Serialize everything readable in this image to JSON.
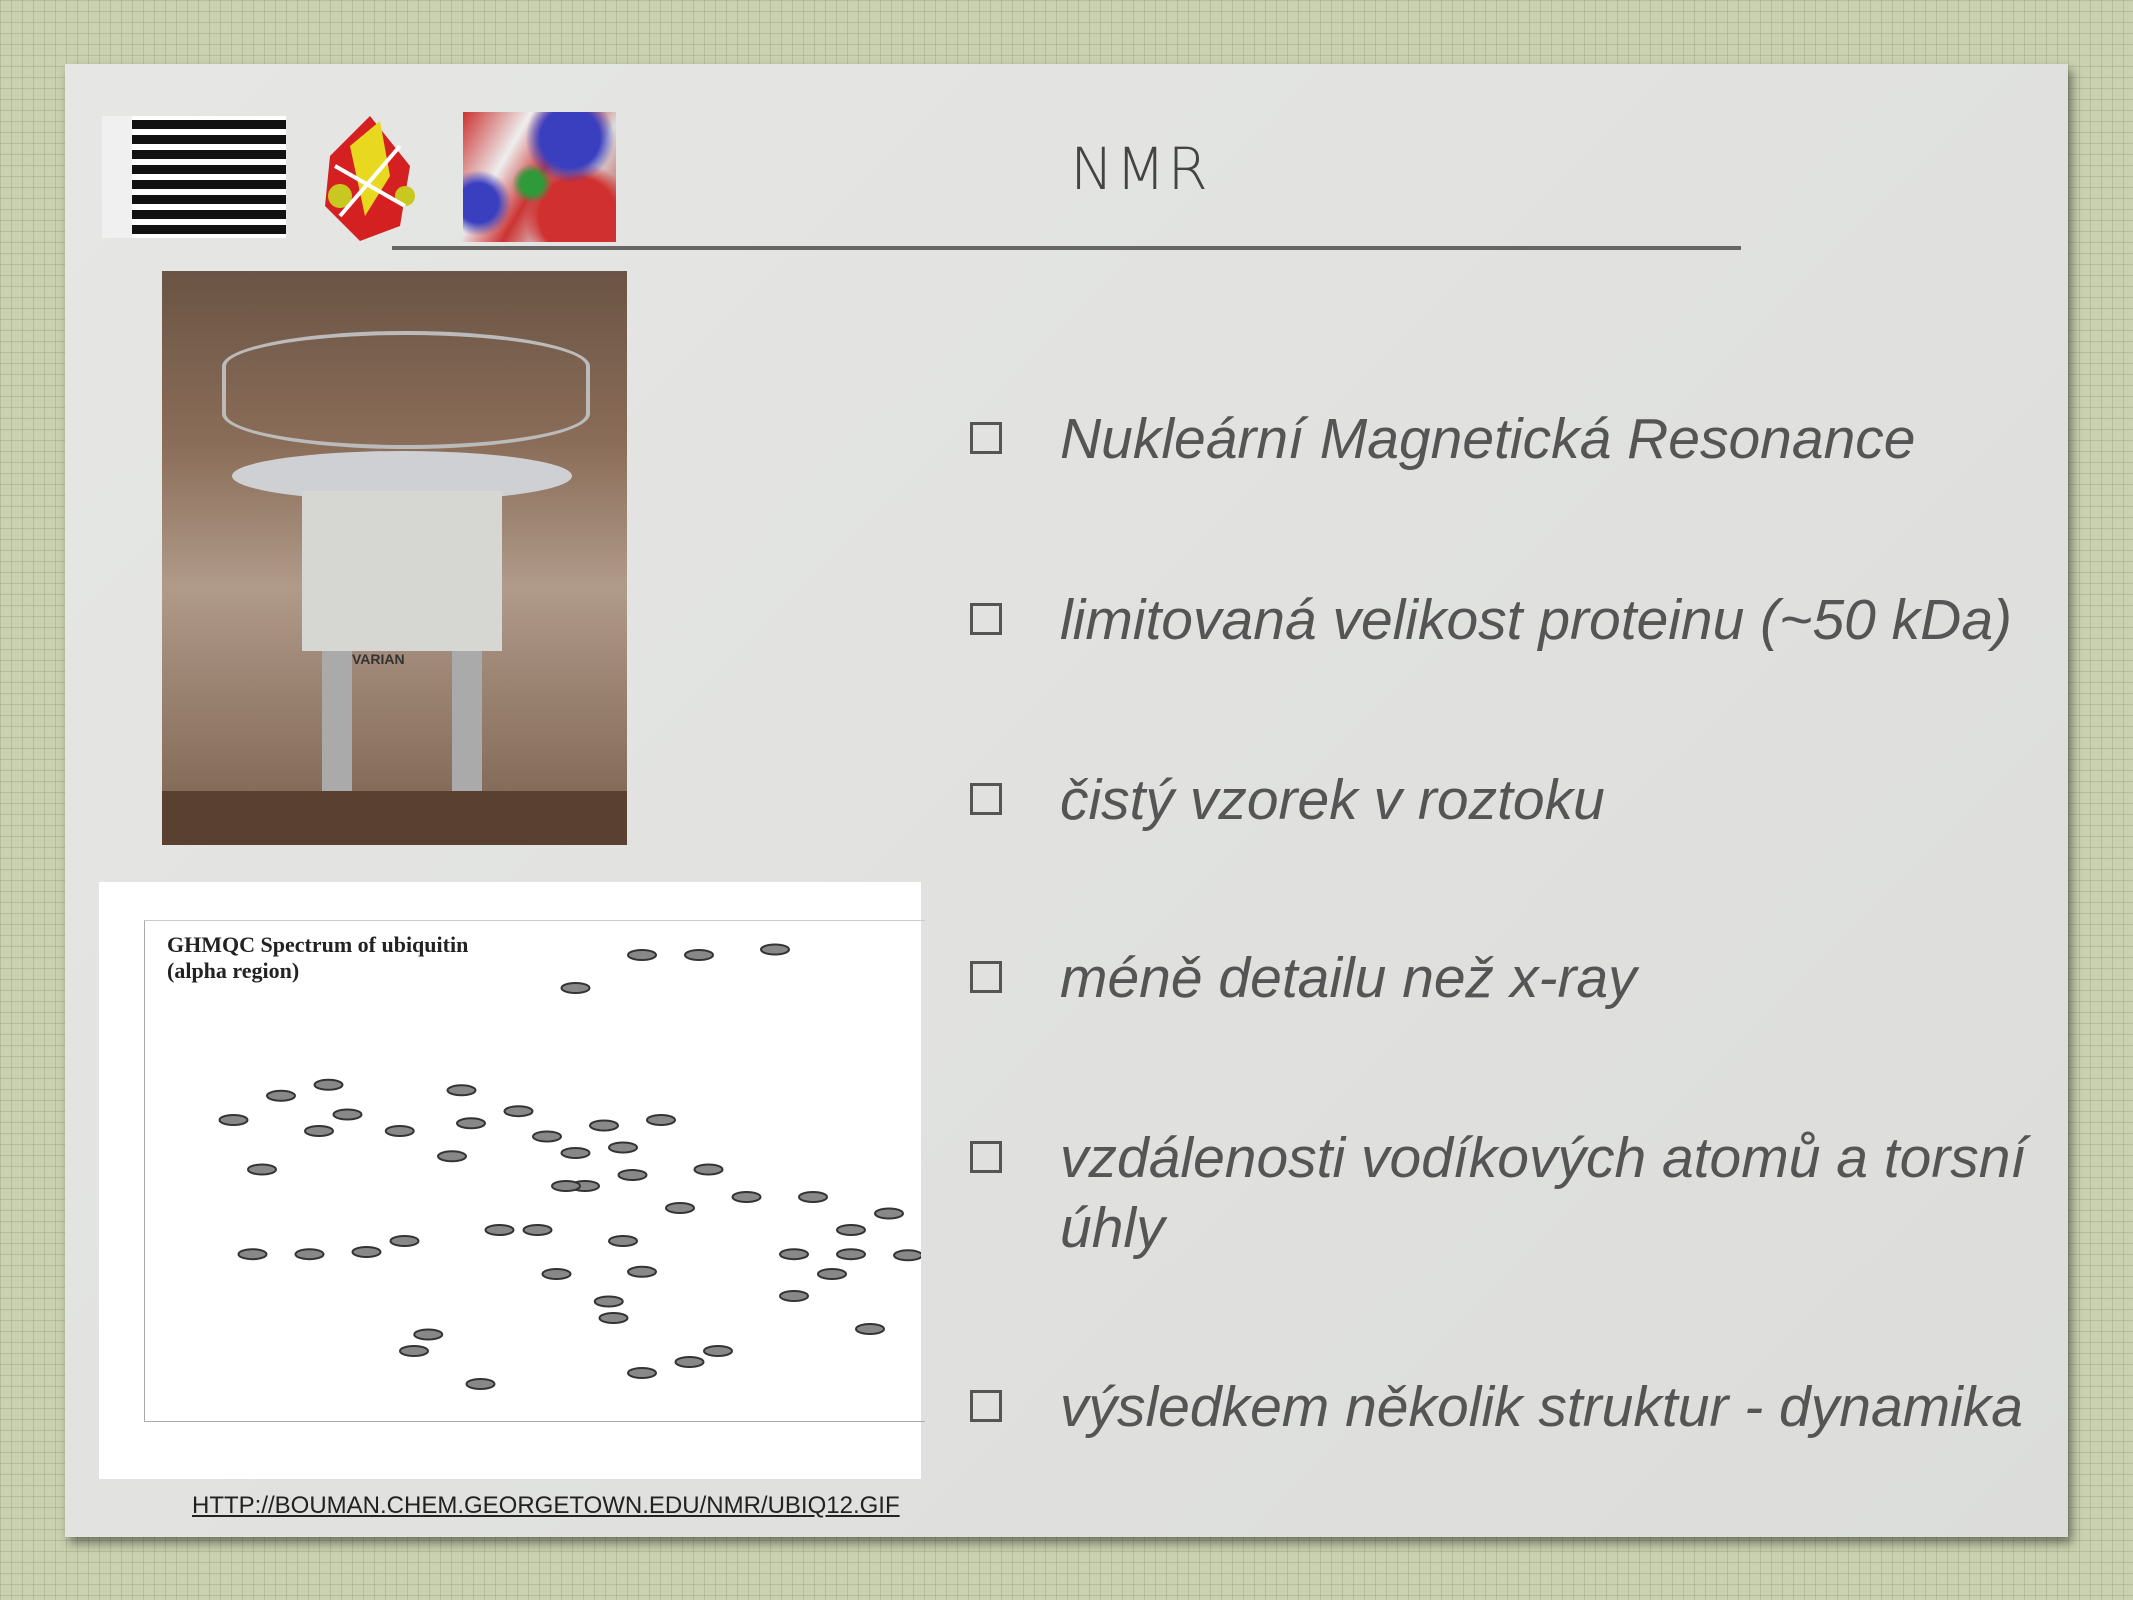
{
  "slide": {
    "title": "NMR",
    "bullets": [
      "Nukleární Magnetická Resonance",
      "limitovaná velikost proteinu (~50 kDa)",
      "čistý vzorek v roztoku",
      "méně detailu než x-ray",
      "vzdálenosti vodíkových atomů a torsní úhly",
      "výsledkem několik struktur - dynamika"
    ],
    "spectrum": {
      "title": "GHMQC Spectrum of ubiquitin",
      "subtitle": "(alpha region)"
    },
    "photo_label": "VARIAN",
    "source_link": "HTTP://BOUMAN.CHEM.GEORGETOWN.EDU/NMR/UBIQ12.GIF"
  }
}
